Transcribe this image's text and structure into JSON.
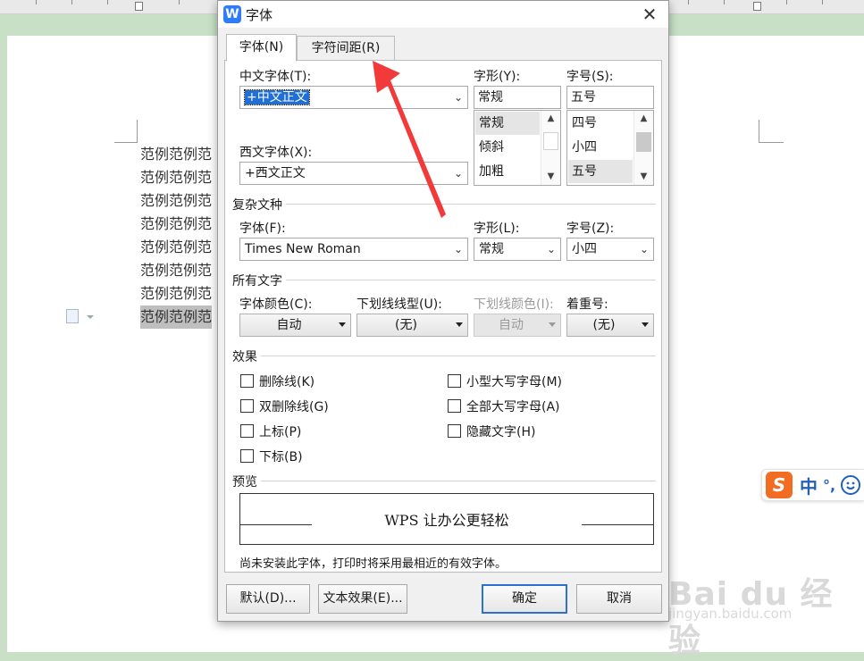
{
  "document": {
    "lines": [
      "范例范例范",
      "范例范例范",
      "范例范例范",
      "范例范例范",
      "范例范例范",
      "范例范例范",
      "范例范例范",
      "范例范例范"
    ]
  },
  "ime": {
    "logo": "S",
    "lang": "中",
    "punct": "°,",
    "smile_icon": "smile-icon"
  },
  "watermark": {
    "main": "Bai du 经验",
    "sub": "jingyan.baidu.com"
  },
  "dialog": {
    "app_icon": "W",
    "title": "字体",
    "close": "✕",
    "tabs": [
      {
        "label": "字体(N)",
        "active": true
      },
      {
        "label": "字符间距(R)",
        "active": false
      }
    ],
    "chinese_font": {
      "label": "中文字体(T):",
      "value": "+中文正文"
    },
    "western_font": {
      "label": "西文字体(X):",
      "value": "+西文正文"
    },
    "style": {
      "label": "字形(Y):",
      "value": "常规",
      "items": [
        "常规",
        "倾斜",
        "加粗"
      ],
      "selected": 0
    },
    "size": {
      "label": "字号(S):",
      "value": "五号",
      "items": [
        "四号",
        "小四",
        "五号"
      ],
      "selected": 2
    },
    "complex": {
      "section": "复杂文种",
      "font_label": "字体(F):",
      "font_value": "Times New Roman",
      "style_label": "字形(L):",
      "style_value": "常规",
      "size_label": "字号(Z):",
      "size_value": "小四"
    },
    "all_text": {
      "section": "所有文字",
      "color_label": "字体颜色(C):",
      "color_value": "自动",
      "underline_label": "下划线线型(U):",
      "underline_value": "(无)",
      "underline_color_label": "下划线颜色(I):",
      "underline_color_value": "自动",
      "emphasis_label": "着重号:",
      "emphasis_value": "(无)"
    },
    "effects": {
      "section": "效果",
      "left": [
        "删除线(K)",
        "双删除线(G)",
        "上标(P)",
        "下标(B)"
      ],
      "right": [
        "小型大写字母(M)",
        "全部大写字母(A)",
        "隐藏文字(H)"
      ]
    },
    "preview": {
      "section": "预览",
      "text": "WPS 让办公更轻松"
    },
    "note": "尚未安装此字体，打印时将采用最相近的有效字体。",
    "buttons": {
      "default": "默认(D)...",
      "text_effect": "文本效果(E)...",
      "ok": "确定",
      "cancel": "取消"
    },
    "arrow_icon": "dropdown-arrow-icon"
  },
  "colors": {
    "selection": "#1f6fd6",
    "annotation_arrow": "#f23a3a",
    "primary_border": "#2f6fcf",
    "ime_orange": "#f26c22"
  }
}
